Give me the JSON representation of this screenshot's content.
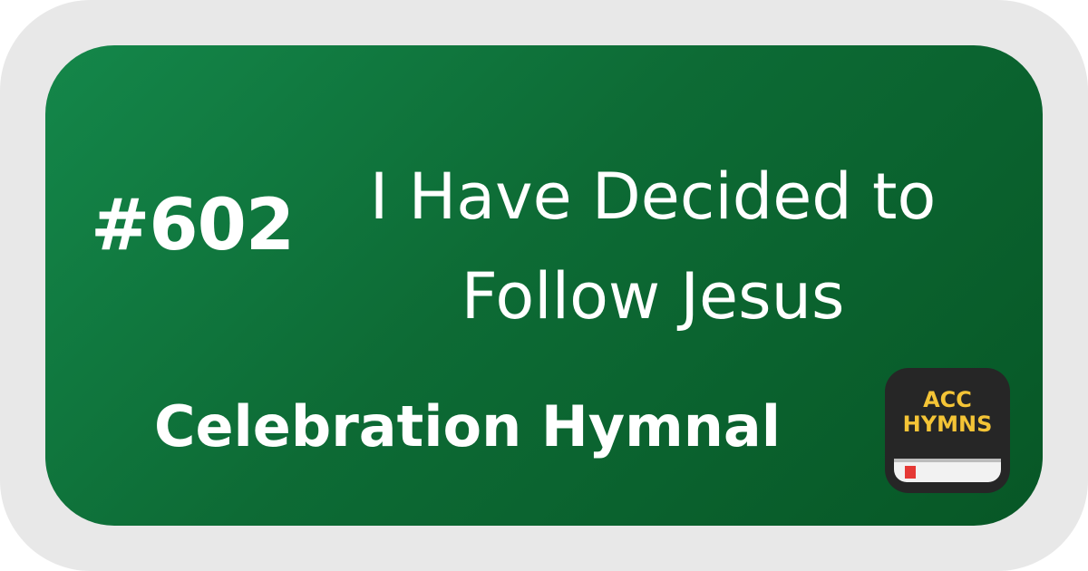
{
  "hymn": {
    "number": "#602",
    "title_line1": "I Have Decided to",
    "title_line2": "Follow Jesus",
    "hymnal": "Celebration Hymnal"
  },
  "logo": {
    "line1": "ACC",
    "line2": "HYMNS"
  },
  "colors": {
    "card_green": "#0d6b35",
    "frame_gray": "#e8e8e8",
    "logo_gold": "#f4c436",
    "logo_bg": "#262626",
    "ribbon_red": "#e53935"
  }
}
